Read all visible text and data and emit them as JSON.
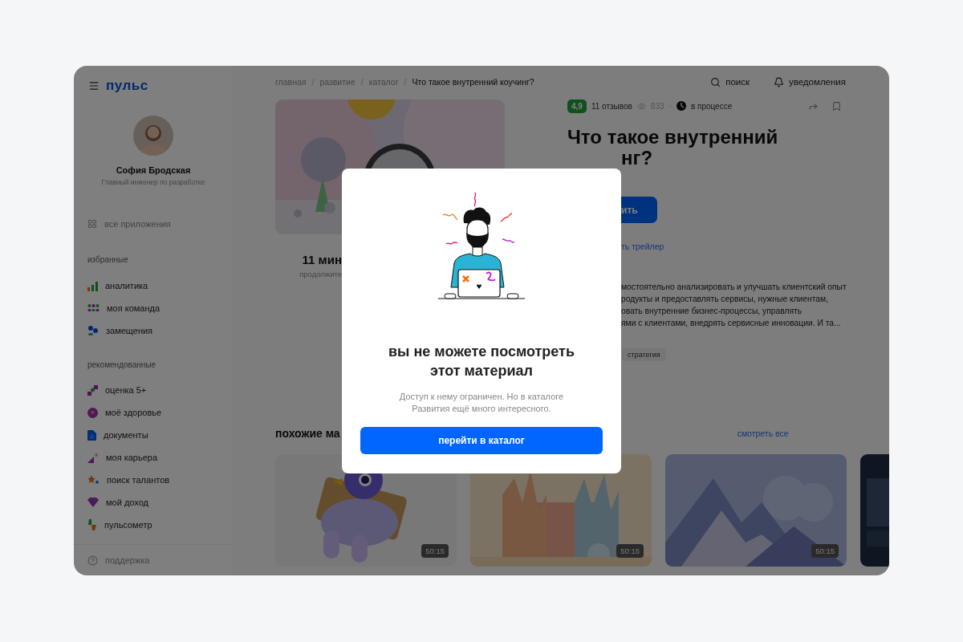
{
  "app": {
    "logo": "пульс"
  },
  "profile": {
    "name": "София Бродская",
    "role": "Главный инженер по разработке"
  },
  "sidebar": {
    "all_apps": "все приложения",
    "sections": [
      {
        "title": "избранные",
        "items": [
          "аналитика",
          "моя команда",
          "замещения"
        ]
      },
      {
        "title": "рекомендованные",
        "items": [
          "оценка 5+",
          "моё здоровье",
          "документы",
          "моя карьера",
          "поиск талантов",
          "мой доход",
          "пульсометр"
        ]
      }
    ],
    "support": "поддержка"
  },
  "breadcrumbs": [
    {
      "label": "главная",
      "current": false
    },
    {
      "label": "развитие",
      "current": false
    },
    {
      "label": "каталог",
      "current": false
    },
    {
      "label": "Что такое внутренний коучинг?",
      "current": true
    }
  ],
  "breadcrumb_separator": "/",
  "header_actions": [
    {
      "kind": "search",
      "label": "поиск"
    },
    {
      "kind": "notifications",
      "label": "уведомления"
    }
  ],
  "material": {
    "duration": "11 мин",
    "duration_caption": "продолжите",
    "rating": "4,9",
    "reviews": "11 отзывов",
    "views": "833",
    "separator": "·",
    "status": "в процессе",
    "title_lines": [
      "Что такое внутренний",
      "нг?"
    ],
    "primary_button": "ить",
    "trailer_link": "ть трейлер",
    "description_lines": [
      "мостоятельно анализировать и улучшать клиентский опыт",
      "родукты и предоставлять сервисы, нужные клиентам,",
      "овать внутренние бизнес-процессы, управлять",
      "ями с клиентами, внедрять сервисные инновации. И та..."
    ],
    "tag": "стратегия"
  },
  "similar": {
    "title": "похожие ма",
    "see_all": "смотреть все",
    "cards": [
      {
        "kind": "picture",
        "duration": "50:15"
      },
      {
        "kind": "picture",
        "duration": "50:15"
      },
      {
        "kind": "picture",
        "duration": "50:15"
      },
      {
        "kind": "picture"
      }
    ]
  },
  "modal": {
    "title": "вы не можете посмотреть этот материал",
    "text": "Доступ к нему ограничен. Но в каталоге Развития ещё много интересного.",
    "button": "перейти в каталог"
  }
}
